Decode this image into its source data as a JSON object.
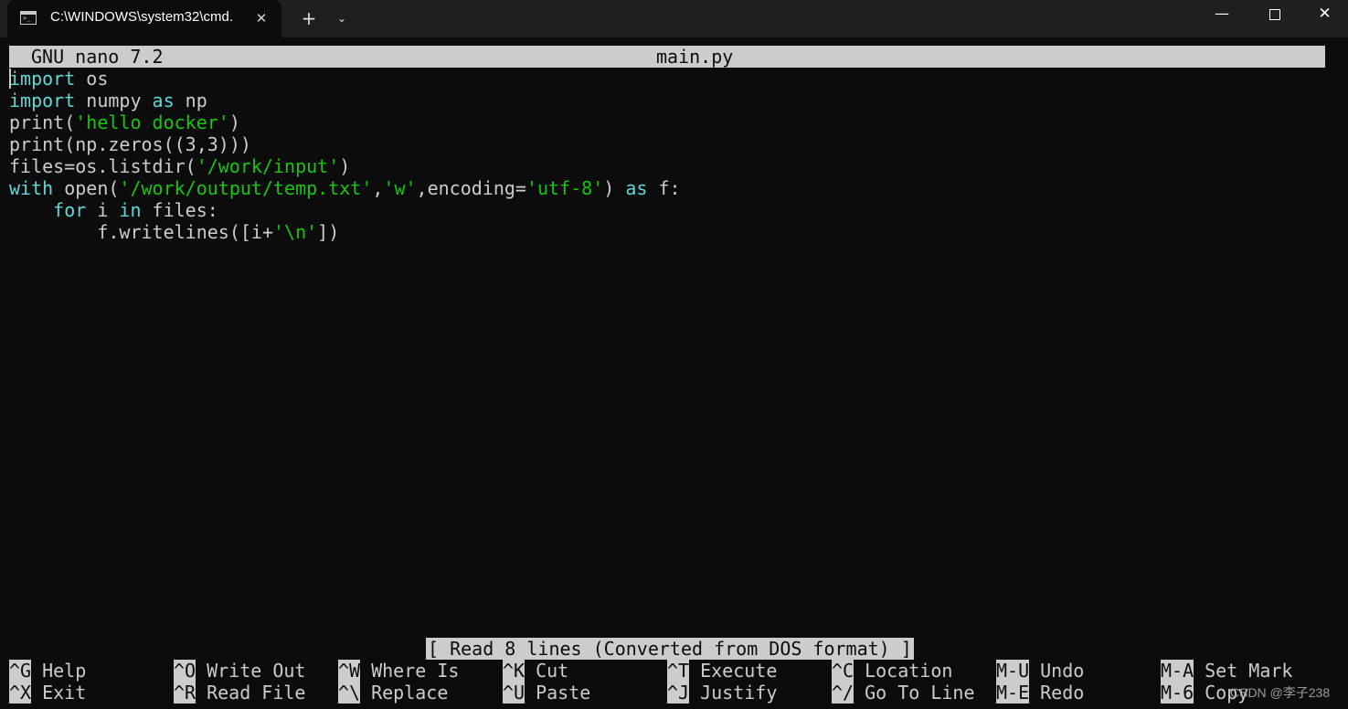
{
  "window": {
    "tab_title": "C:\\WINDOWS\\system32\\cmd.",
    "tab_close_glyph": "✕",
    "new_tab_glyph": "+",
    "dropdown_glyph": "⌄",
    "minimize_glyph": "—",
    "close_glyph": "✕"
  },
  "nano": {
    "version": "GNU nano 7.2",
    "filename": "main.py",
    "status": "[ Read 8 lines (Converted from DOS format) ]"
  },
  "code": {
    "l1": [
      "import",
      " os"
    ],
    "l2": [
      "import",
      " numpy ",
      "as",
      " np"
    ],
    "l3": [
      "print(",
      "'hello docker'",
      ")"
    ],
    "l4": "print(np.zeros((3,3)))",
    "l5": [
      "files=os.listdir(",
      "'/work/input'",
      ")"
    ],
    "l6": [
      "with",
      " open(",
      "'/work/output/temp.txt'",
      ",",
      "'w'",
      ",encoding=",
      "'utf-8'",
      ") ",
      "as",
      " f:"
    ],
    "l7": [
      "    ",
      "for",
      " i ",
      "in",
      " files:"
    ],
    "l8": [
      "        f.writelines([i+",
      "'\\n'",
      "])"
    ]
  },
  "shortcuts": {
    "help": {
      "key": "^G",
      "label": "Help"
    },
    "exit": {
      "key": "^X",
      "label": "Exit"
    },
    "write_out": {
      "key": "^O",
      "label": "Write Out"
    },
    "read_file": {
      "key": "^R",
      "label": "Read File"
    },
    "where_is": {
      "key": "^W",
      "label": "Where Is"
    },
    "replace": {
      "key": "^\\",
      "label": "Replace"
    },
    "cut": {
      "key": "^K",
      "label": "Cut"
    },
    "paste": {
      "key": "^U",
      "label": "Paste"
    },
    "execute": {
      "key": "^T",
      "label": "Execute"
    },
    "justify": {
      "key": "^J",
      "label": "Justify"
    },
    "location": {
      "key": "^C",
      "label": "Location"
    },
    "go_to_line": {
      "key": "^/",
      "label": "Go To Line"
    },
    "undo": {
      "key": "M-U",
      "label": "Undo"
    },
    "redo": {
      "key": "M-E",
      "label": "Redo"
    },
    "set_mark": {
      "key": "M-A",
      "label": "Set Mark"
    },
    "copy": {
      "key": "M-6",
      "label": "Copy"
    }
  },
  "watermark": "CSDN @李子238"
}
